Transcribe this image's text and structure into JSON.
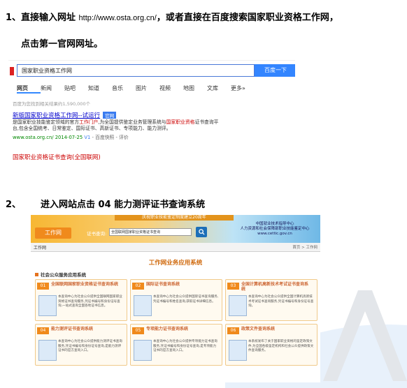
{
  "colors": {
    "accent_orange": "#f08a1c",
    "link_blue": "#0000cc",
    "baidu_blue": "#3385ff",
    "highlight_red": "#cc0000"
  },
  "step1": {
    "num": "1、",
    "text_before": "直接输入网址 ",
    "url": "http://www.osta.org.cn/",
    "text_after": "，或者直接在百度搜索国家职业资格工作网，",
    "line2": "点击第一官网网址。"
  },
  "baidu": {
    "query": "国家职业资格工作网",
    "search_button": "百度一下",
    "tabs": [
      "网页",
      "新闻",
      "贴吧",
      "知道",
      "音乐",
      "图片",
      "视频",
      "地图",
      "文库",
      "更多»"
    ],
    "result_count": "百度为您找到相关结果约1,590,000个",
    "result_title": "新版国家职业资格工作网--试运行",
    "result_badge": "官网",
    "result_desc_1": "是国家职业技能鉴定领域的官方",
    "result_desc_hl1": "工作门户",
    "result_desc_2": ",为全国提供鉴定业务管理系统与",
    "result_desc_hl2": "国家职业资格",
    "result_desc_3": "证书查询平台,包含全国统考、日常鉴定、国际证书、高新证书、专项能力、能力测评。",
    "result_url": "www.osta.org.cn/ 2014-07-25",
    "result_v": "V1",
    "result_links": "- 百度快照 - 评价",
    "next_result": "国家职业资格证书查询(全国联网)"
  },
  "step2": {
    "num": "2、",
    "text": "进入网站点击 04 能力测评证书查询系统"
  },
  "site": {
    "banner_top": "庆祝职业技能鉴定制度建立20周年",
    "logo": "工作网",
    "cert_label": "证书查询:",
    "cert_select": "全国联网国家职业资格证书查询",
    "search_icon": "search-icon",
    "ministry_1": "中国就业技术指导中心",
    "ministry_2": "人力资源和社会保障部职业技能鉴定中心",
    "ministry_3": "www.cettic.gov.cn",
    "nav_left": "工作网",
    "nav_right": "首页 > 工作网",
    "sys_title": "工作网业务应用系统",
    "section": "社会公众服务应用系统",
    "cards": [
      {
        "num": "01",
        "title": "全国联网国家职业资格证书查询系统",
        "desc": "本查询中心为社会公众提供全国联网国家职业资格证书查询服务,凭证书编号和身份证号查询,一站式查询全国各地证书信息。"
      },
      {
        "num": "02",
        "title": "国际证书查询系统",
        "desc": "本查询中心为社会公众提供国际证书查询服务,凭证书编号和姓名查询,获取证书详细信息。"
      },
      {
        "num": "03",
        "title": "全国计算机高新技术考试证书查询系统",
        "desc": "本查询中心为社会公众提供全国计算机高新技术考试证书查询服务,凭证书编号和身份证号查询。"
      },
      {
        "num": "04",
        "title": "能力测评证书查询系统",
        "desc": "本查询中心为社会公众提供能力测评证书查询服务,凭证书编号和身份证号查询,是能力测评证书的官方查询入口。"
      },
      {
        "num": "05",
        "title": "专项能力证书查询系统",
        "desc": "本查询中心为社会公众提供专项能力证书查询服务,凭证书编号和身份证号查询,是专项能力证书的官方查询入口。"
      },
      {
        "num": "06",
        "title": "政策文件查询系统",
        "desc": "本系统发布了关于国家职业资格的鉴定政策文件,为全国各级鉴定机构和社会公众提供政策文件查询服务。"
      }
    ]
  }
}
